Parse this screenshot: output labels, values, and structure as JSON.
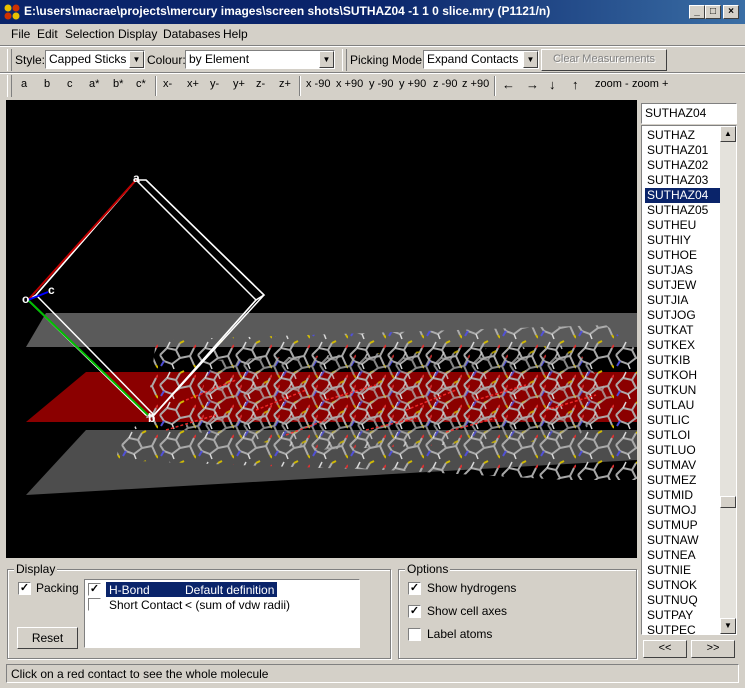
{
  "window": {
    "title": "E:\\users\\macrae\\projects\\mercury images\\screen shots\\SUTHAZ04 -1 1 0 slice.mry (P1121/n)",
    "minimize": "_",
    "maximize": "□",
    "close": "×"
  },
  "menu": [
    "File",
    "Edit",
    "Selection",
    "Display",
    "Databases",
    "Help"
  ],
  "toolbar1": {
    "style_label": "Style:",
    "style_value": "Capped Sticks",
    "colour_label": "Colour:",
    "colour_value": "by Element",
    "picking_label": "Picking Mode:",
    "picking_value": "Expand Contacts",
    "clear_label": "Clear Measurements"
  },
  "toolbar2": [
    "a",
    "b",
    "c",
    "a*",
    "b*",
    "c*",
    "x-",
    "x+",
    "y-",
    "y+",
    "z-",
    "z+",
    "x -90",
    "x +90",
    "y -90",
    "y +90",
    "z -90",
    "z +90",
    "←",
    "→",
    "↓",
    "↑",
    "zoom -",
    "zoom +"
  ],
  "viewport": {
    "axis_labels": [
      "a",
      "o",
      "c",
      "b"
    ],
    "colors": {
      "background": "#000000",
      "plane_red": "#8b0000",
      "plane_grey": "#5a5a5a",
      "a_axis": "#c00000",
      "b_axis": "#00c000",
      "c_axis": "#0000ff"
    }
  },
  "search": {
    "value": "SUTHAZ04"
  },
  "list": {
    "items": [
      "SUTHAZ",
      "SUTHAZ01",
      "SUTHAZ02",
      "SUTHAZ03",
      "SUTHAZ04",
      "SUTHAZ05",
      "SUTHEU",
      "SUTHIY",
      "SUTHOE",
      "SUTJAS",
      "SUTJEW",
      "SUTJIA",
      "SUTJOG",
      "SUTKAT",
      "SUTKEX",
      "SUTKIB",
      "SUTKOH",
      "SUTKUN",
      "SUTLAU",
      "SUTLIC",
      "SUTLOI",
      "SUTLUO",
      "SUTMAV",
      "SUTMEZ",
      "SUTMID",
      "SUTMOJ",
      "SUTMUP",
      "SUTNAW",
      "SUTNEA",
      "SUTNIE",
      "SUTNOK",
      "SUTNUQ",
      "SUTPAY",
      "SUTPEC"
    ],
    "selected": "SUTHAZ04",
    "prev": "<<",
    "next": ">>"
  },
  "display_group": {
    "title": "Display",
    "packing_label": "Packing",
    "packing_checked": "✓",
    "reset_label": "Reset",
    "contacts": [
      {
        "name": "H-Bond",
        "definition": "Default definition",
        "checked": "✓"
      },
      {
        "name": "Short Contact",
        "definition": "< (sum of vdw radii)",
        "checked": ""
      }
    ]
  },
  "options_group": {
    "title": "Options",
    "items": [
      {
        "label": "Show hydrogens",
        "checked": "✓"
      },
      {
        "label": "Show cell axes",
        "checked": "✓"
      },
      {
        "label": "Label atoms",
        "checked": ""
      }
    ]
  },
  "status": "Click on a red contact to see the whole molecule"
}
